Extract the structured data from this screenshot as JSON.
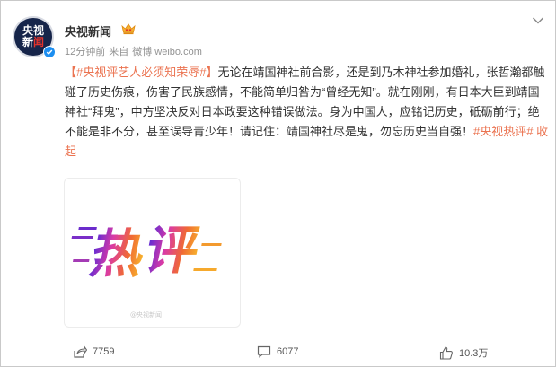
{
  "header": {
    "avatar_line1": "央视",
    "avatar_line2a": "新",
    "avatar_line2b": "闻",
    "author": "央视新闻",
    "crown_icon": "vip-crown-icon",
    "time": "12分钟前",
    "source_prefix": "来自",
    "source_app": "微博 weibo.com"
  },
  "post": {
    "hashtag": "【#央视评艺人必须知荣辱#】",
    "body": "无论在靖国神社前合影，还是到乃木神社参加婚礼，张哲瀚都触碰了历史伤痕，伤害了民族感情，不能简单归咎为“曾经无知”。就在刚刚，有日本大臣到靖国神社“拜鬼”，中方坚决反对日本政要这种错误做法。身为中国人，应铭记历史，砥砺前行；绝不能是非不分，甚至误导青少年！请记住：靖国神社尽是鬼，勿忘历史当自强！",
    "tag2": "#央视热评#",
    "collapse": "收起"
  },
  "image": {
    "char1": "热",
    "char2": "评",
    "watermark": "@央视新闻"
  },
  "footer": {
    "share_count": "7759",
    "comment_count": "6077",
    "like_count": "10.3万"
  },
  "colors": {
    "highlight": "#eb7350",
    "avatar_bg": "#16254a",
    "verify": "#1d8ef0"
  }
}
